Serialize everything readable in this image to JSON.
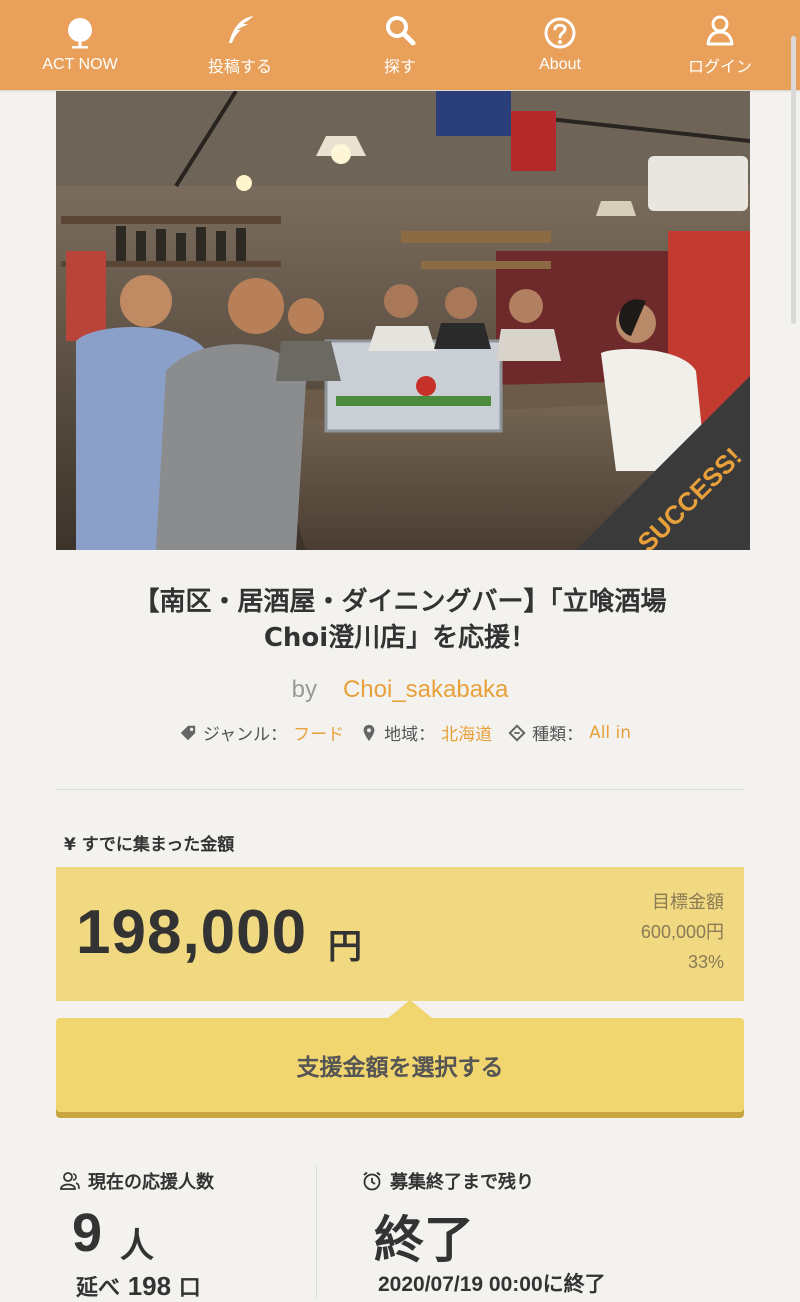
{
  "nav": {
    "items": [
      {
        "label": "ACT NOW",
        "icon": "globe-icon"
      },
      {
        "label": "投稿する",
        "icon": "quill-icon"
      },
      {
        "label": "探す",
        "icon": "search-icon"
      },
      {
        "label": "About",
        "icon": "question-icon"
      },
      {
        "label": "ログイン",
        "icon": "user-icon"
      }
    ]
  },
  "hero": {
    "badge": "SUCCESS!"
  },
  "project": {
    "title_line1": "【南区・居酒屋・ダイニングバー】「立喰酒場",
    "title_line2": "Choi澄川店」を応援！",
    "by": "by",
    "author": "Choi_sakabaka",
    "genre_label": "ジャンル：",
    "genre": "フード",
    "region_label": "地域：",
    "region": "北海道",
    "type_label": "種類：",
    "type": "All in"
  },
  "funding": {
    "collected_label": "¥  すでに集まった金額",
    "amount": "198,000",
    "amount_unit": "円",
    "goal_label": "目標金額",
    "goal": "600,000円",
    "percent": "33%",
    "select_button": "支援金額を選択する"
  },
  "stats": {
    "supporters_label": "現在の応援人数",
    "supporters_count": "9",
    "supporters_unit": "人",
    "total_label": "延べ",
    "total_count": "198",
    "total_unit": "口",
    "remaining_label": "募集終了まで残り",
    "remaining_value": "終了",
    "end_date": "2020/07/19 00:00に終了"
  },
  "colors": {
    "nav": "#e8a05a",
    "accent": "#e8a03a",
    "amount_box": "#f0d981",
    "button": "#f1d56e"
  }
}
